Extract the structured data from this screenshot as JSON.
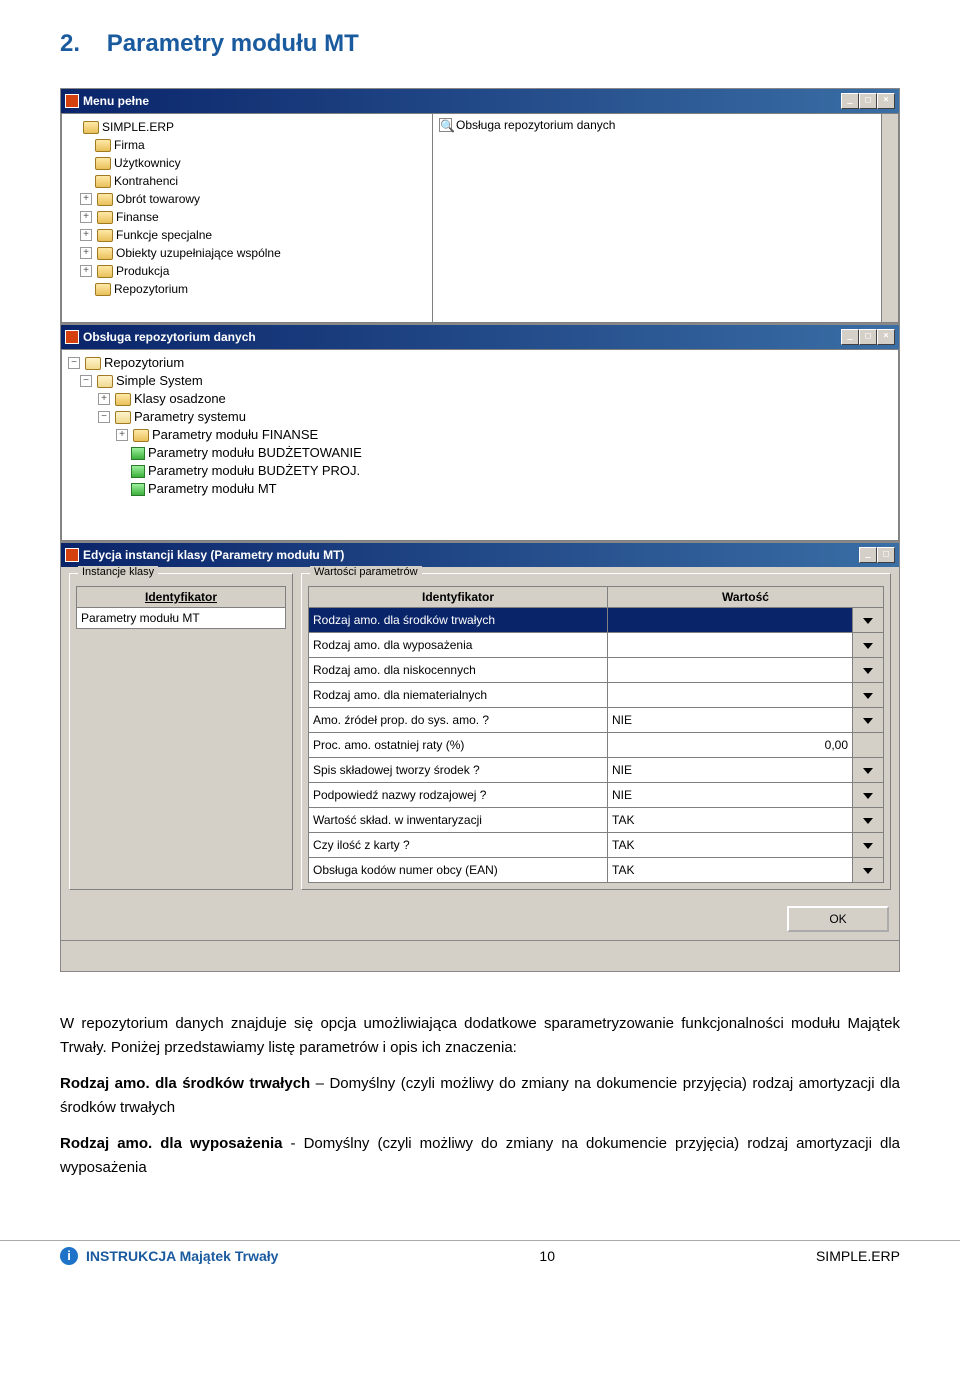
{
  "section": {
    "number": "2.",
    "title": "Parametry modułu MT"
  },
  "window1": {
    "title": "Menu pełne",
    "tree": [
      {
        "label": "SIMPLE.ERP",
        "icon": "folder",
        "indent": 0,
        "expander": "none"
      },
      {
        "label": "Firma",
        "icon": "folder",
        "indent": 1,
        "expander": "none"
      },
      {
        "label": "Użytkownicy",
        "icon": "folder",
        "indent": 1,
        "expander": "none"
      },
      {
        "label": "Kontrahenci",
        "icon": "folder",
        "indent": 1,
        "expander": "none"
      },
      {
        "label": "Obrót towarowy",
        "icon": "folder",
        "indent": 1,
        "expander": "plus"
      },
      {
        "label": "Finanse",
        "icon": "folder",
        "indent": 1,
        "expander": "plus"
      },
      {
        "label": "Funkcje specjalne",
        "icon": "folder",
        "indent": 1,
        "expander": "plus"
      },
      {
        "label": "Obiekty uzupełniające wspólne",
        "icon": "folder",
        "indent": 1,
        "expander": "plus"
      },
      {
        "label": "Produkcja",
        "icon": "folder",
        "indent": 1,
        "expander": "plus"
      },
      {
        "label": "Repozytorium",
        "icon": "folder",
        "indent": 1,
        "expander": "none"
      }
    ],
    "right_item": "Obsługa repozytorium danych"
  },
  "window2": {
    "title": "Obsługa repozytorium danych",
    "tree": [
      {
        "label": "Repozytorium",
        "icon": "folder-open",
        "indent": 0,
        "expander": "minus"
      },
      {
        "label": "Simple System",
        "icon": "folder-open",
        "indent": 1,
        "expander": "minus"
      },
      {
        "label": "Klasy osadzone",
        "icon": "folder",
        "indent": 2,
        "expander": "plus"
      },
      {
        "label": "Parametry systemu",
        "icon": "folder-open",
        "indent": 2,
        "expander": "minus"
      },
      {
        "label": "Parametry modułu FINANSE",
        "icon": "folder",
        "indent": 3,
        "expander": "plus"
      },
      {
        "label": "Parametry modułu BUDŻETOWANIE",
        "icon": "param",
        "indent": 3,
        "expander": "none"
      },
      {
        "label": "Parametry modułu BUDŻETY PROJ.",
        "icon": "param",
        "indent": 3,
        "expander": "none"
      },
      {
        "label": "Parametry modułu MT",
        "icon": "param",
        "indent": 3,
        "expander": "none"
      }
    ]
  },
  "window3": {
    "title": "Edycja instancji klasy (Parametry modułu MT)",
    "group_left": "Instancje klasy",
    "group_right": "Wartości parametrów",
    "left_header": "Identyfikator",
    "left_row": "Parametry modułu MT",
    "table": {
      "headers": {
        "ident": "Identyfikator",
        "value": "Wartość"
      },
      "rows": [
        {
          "ident": "Rodzaj amo. dla środków trwałych",
          "value": "",
          "dd": true,
          "selected": true
        },
        {
          "ident": "Rodzaj amo. dla wyposażenia",
          "value": "",
          "dd": true
        },
        {
          "ident": "Rodzaj amo. dla niskocennych",
          "value": "",
          "dd": true
        },
        {
          "ident": "Rodzaj amo. dla niematerialnych",
          "value": "",
          "dd": true
        },
        {
          "ident": "Amo. źródeł prop. do sys. amo. ?",
          "value": "NIE",
          "dd": true
        },
        {
          "ident": "Proc. amo. ostatniej raty (%)",
          "value": "0,00",
          "dd": false,
          "align": "right"
        },
        {
          "ident": "Spis składowej tworzy środek ?",
          "value": "NIE",
          "dd": true
        },
        {
          "ident": "Podpowiedź nazwy rodzajowej ?",
          "value": "NIE",
          "dd": true
        },
        {
          "ident": "Wartość skład. w inwentaryzacji",
          "value": "TAK",
          "dd": true
        },
        {
          "ident": "Czy ilość z karty ?",
          "value": "TAK",
          "dd": true
        },
        {
          "ident": "Obsługa kodów numer obcy (EAN)",
          "value": "TAK",
          "dd": true
        }
      ]
    },
    "ok": "OK"
  },
  "body": {
    "p1": "W repozytorium danych znajduje się opcja umożliwiająca dodatkowe sparametryzowanie funkcjonalności modułu Majątek Trwały. Poniżej przedstawiamy listę parametrów i opis ich znaczenia:",
    "p2a": "Rodzaj amo. dla środków trwałych",
    "p2b": " – Domyślny (czyli możliwy do zmiany na dokumencie przyjęcia) rodzaj amortyzacji dla środków trwałych",
    "p3a": "Rodzaj amo. dla wyposażenia",
    "p3b": " - Domyślny (czyli możliwy do zmiany na dokumencie przyjęcia) rodzaj amortyzacji dla wyposażenia"
  },
  "footer": {
    "title": "INSTRUKCJA Majątek Trwały",
    "page": "10",
    "erp": "SIMPLE.ERP"
  }
}
